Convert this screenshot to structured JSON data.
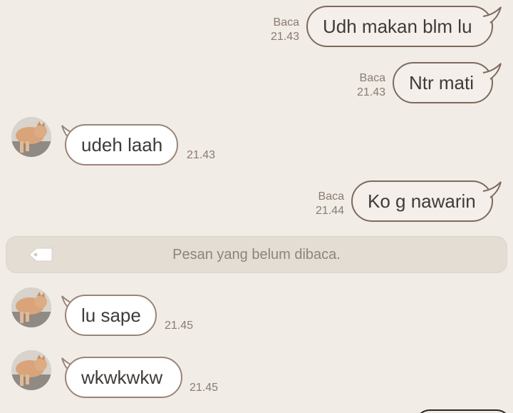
{
  "messages": {
    "out1": {
      "text": "Udh makan blm lu",
      "read": "Baca",
      "time": "21.43"
    },
    "out2": {
      "text": "Ntr mati",
      "read": "Baca",
      "time": "21.43"
    },
    "in1": {
      "text": "udeh laah",
      "time": "21.43"
    },
    "out3": {
      "text": "Ko g nawarin",
      "read": "Baca",
      "time": "21.44"
    },
    "in2": {
      "text": "lu sape",
      "time": "21.45"
    },
    "in3": {
      "text": "wkwkwkw",
      "time": "21.45"
    }
  },
  "divider": {
    "label": "Pesan yang belum dibaca."
  },
  "icons": {
    "avatar": "cat-avatar-photo",
    "tag": "tag-icon"
  },
  "colors": {
    "background": "#f1ece6",
    "bubble_border": "#7d6a5e",
    "meta_text": "#8a7b71"
  }
}
